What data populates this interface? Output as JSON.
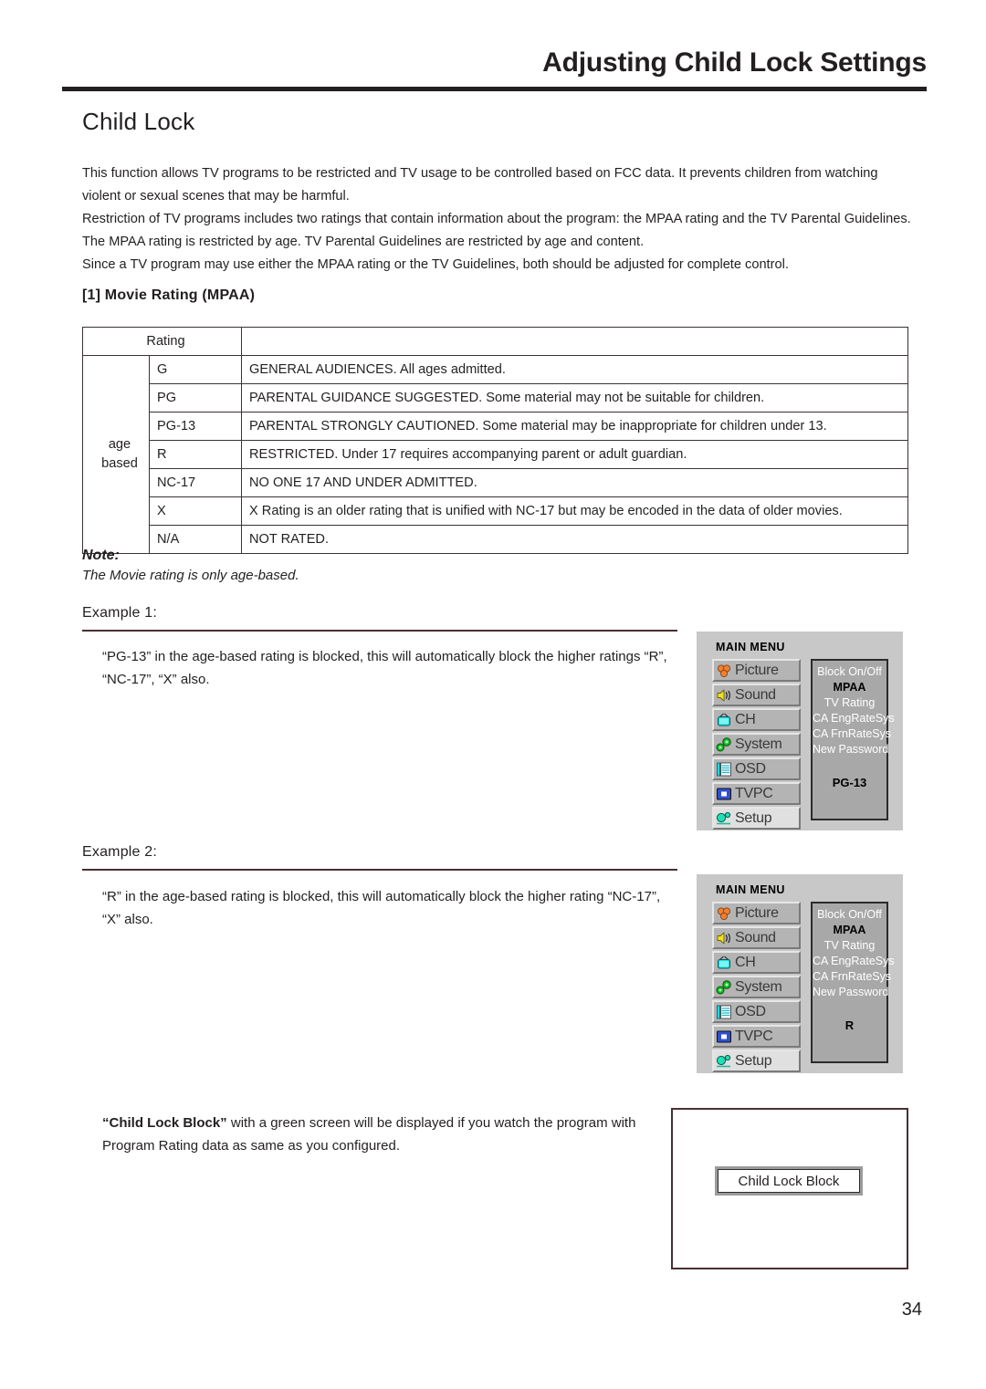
{
  "header": {
    "title": "Adjusting Child Lock Settings"
  },
  "section": {
    "heading": "Child Lock",
    "paragraphs": [
      "This function allows TV programs to be restricted and TV usage to be controlled based on FCC data. It prevents children from watching violent or sexual scenes that may be harmful.",
      "Restriction of TV programs includes two ratings that contain information about the program: the MPAA rating and the TV Parental Guidelines. The MPAA rating is restricted by age. TV Parental Guidelines are restricted by age and content.",
      "Since a TV program may use either the MPAA rating or the TV Guidelines, both should be adjusted for complete control."
    ]
  },
  "subsection": {
    "label": "[1] Movie Rating (MPAA)"
  },
  "rating_table": {
    "header_rating": "Rating",
    "header_desc": "",
    "group_label_line1": "age",
    "group_label_line2": "based",
    "rows": [
      {
        "code": "G",
        "desc": "GENERAL AUDIENCES. All ages admitted."
      },
      {
        "code": "PG",
        "desc": "PARENTAL GUIDANCE SUGGESTED. Some material may not be suitable for children."
      },
      {
        "code": "PG-13",
        "desc": "PARENTAL STRONGLY CAUTIONED. Some material may be inappropriate for children under 13."
      },
      {
        "code": "R",
        "desc": "RESTRICTED. Under 17 requires accompanying parent or adult guardian."
      },
      {
        "code": "NC-17",
        "desc": "NO ONE 17 AND UNDER ADMITTED."
      },
      {
        "code": "X",
        "desc": "X Rating is an older rating that is unified with NC-17 but may be encoded in the data of older movies."
      },
      {
        "code": "N/A",
        "desc": "NOT RATED."
      }
    ]
  },
  "note": {
    "title": "Note:",
    "text": "The Movie rating is only age-based."
  },
  "examples": [
    {
      "label": "Example 1:",
      "body": "“PG-13” in the age-based rating is blocked, this will automatically block the higher ratings “R”, “NC-17”, “X” also."
    },
    {
      "label": "Example 2:",
      "body": "“R” in the age-based rating is blocked, this will automatically block the higher rating “NC-17”, “X” also."
    }
  ],
  "osd_menu": {
    "title": "MAIN MENU",
    "items": [
      {
        "label": "Picture",
        "icon": "picture-icon",
        "selected": false
      },
      {
        "label": "Sound",
        "icon": "sound-icon",
        "selected": false
      },
      {
        "label": "CH",
        "icon": "channel-icon",
        "selected": false
      },
      {
        "label": "System",
        "icon": "system-icon",
        "selected": false
      },
      {
        "label": "OSD",
        "icon": "osd-icon",
        "selected": false
      },
      {
        "label": "TVPC",
        "icon": "tvpc-icon",
        "selected": false
      },
      {
        "label": "Setup",
        "icon": "setup-icon",
        "selected": true
      }
    ],
    "submenu": [
      {
        "label": "Block On/Off",
        "active": false
      },
      {
        "label": "MPAA",
        "active": true
      },
      {
        "label": "TV Rating",
        "active": false
      },
      {
        "label": "CA EngRateSys",
        "active": false
      },
      {
        "label": "CA FrnRateSys",
        "active": false
      },
      {
        "label": "New Password",
        "active": false
      }
    ],
    "value_example1": "PG-13",
    "value_example2": "R",
    "colors": {
      "panel_bg": "#c8c8c8",
      "item_bg": "#b4b4b4",
      "submenu_bg": "#a8a8a8",
      "icon_picture": "#f08030",
      "icon_sound": "#f0e020",
      "icon_channel": "#20e0e0",
      "icon_system": "#10c020",
      "icon_osd": "#20d8e0",
      "icon_tvpc": "#3050d0",
      "icon_setup": "#20e0b8"
    }
  },
  "child_lock_block": {
    "text_bold": "“Child Lock Block”",
    "text_rest": " with a green screen will be displayed if you watch the program with Program Rating data as same as you configured.",
    "badge_label": "Child Lock Block"
  },
  "footer": {
    "page_number": "34"
  }
}
